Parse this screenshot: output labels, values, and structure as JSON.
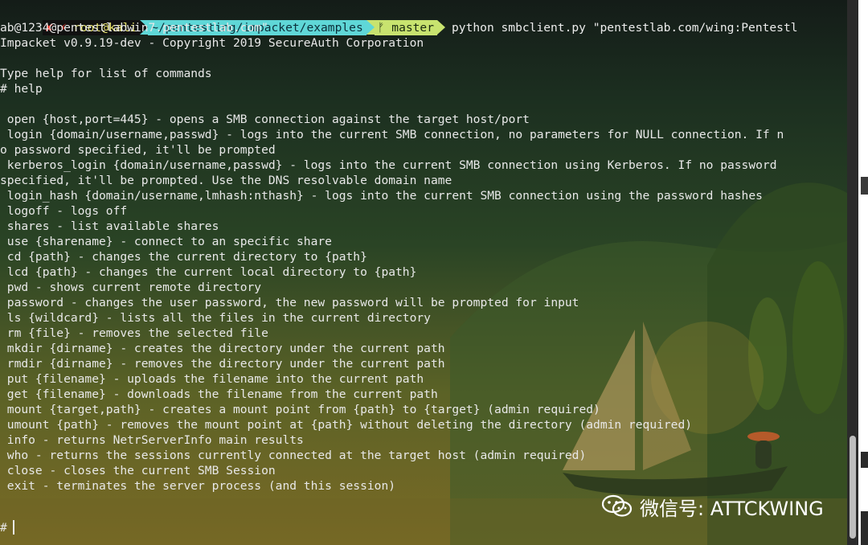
{
  "prompt": {
    "status": "✘ ⚡",
    "user": "root@kali",
    "dir": "~/pentesting/impacket/examples",
    "git": "ᚠ master",
    "command": "python smbclient.py \"pentestlab.com/wing:Pentestl"
  },
  "output_lines": [
    "ab@1234@pentestlabwin7.pentestlab.com\"",
    "Impacket v0.9.19-dev - Copyright 2019 SecureAuth Corporation",
    "",
    "Type help for list of commands",
    "# help",
    "",
    " open {host,port=445} - opens a SMB connection against the target host/port",
    " login {domain/username,passwd} - logs into the current SMB connection, no parameters for NULL connection. If n",
    "o password specified, it'll be prompted",
    " kerberos_login {domain/username,passwd} - logs into the current SMB connection using Kerberos. If no password",
    "specified, it'll be prompted. Use the DNS resolvable domain name",
    " login_hash {domain/username,lmhash:nthash} - logs into the current SMB connection using the password hashes",
    " logoff - logs off",
    " shares - list available shares",
    " use {sharename} - connect to an specific share",
    " cd {path} - changes the current directory to {path}",
    " lcd {path} - changes the current local directory to {path}",
    " pwd - shows current remote directory",
    " password - changes the user password, the new password will be prompted for input",
    " ls {wildcard} - lists all the files in the current directory",
    " rm {file} - removes the selected file",
    " mkdir {dirname} - creates the directory under the current path",
    " rmdir {dirname} - removes the directory under the current path",
    " put {filename} - uploads the filename into the current path",
    " get {filename} - downloads the filename from the current path",
    " mount {target,path} - creates a mount point from {path} to {target} (admin required)",
    " umount {path} - removes the mount point at {path} without deleting the directory (admin required)",
    " info - returns NetrServerInfo main results",
    " who - returns the sessions currently connected at the target host (admin required)",
    " close - closes the current SMB Session",
    " exit - terminates the server process (and this session)",
    "",
    "",
    "#"
  ],
  "watermark": "微信号: ATTCKWING",
  "colors": {
    "status": "#ff3b30",
    "dir_segment": "#5fd7d7",
    "git_segment": "#c8e36f",
    "text": "#e8e8e8"
  },
  "icons": [
    "wechat-icon",
    "git-branch-icon",
    "lightning-icon"
  ]
}
